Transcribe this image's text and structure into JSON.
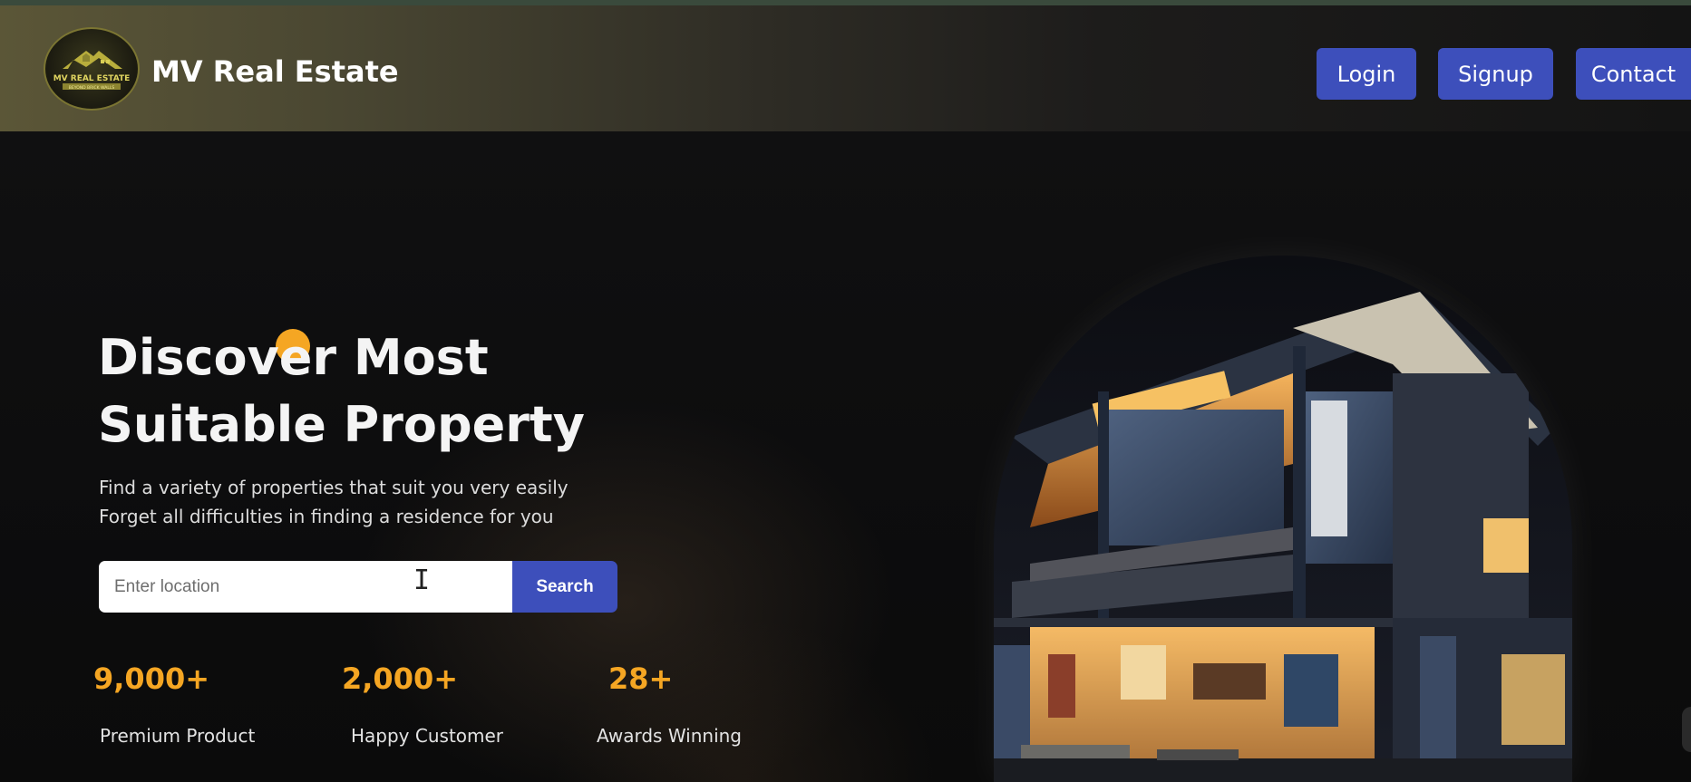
{
  "header": {
    "logo": {
      "text": "MV REAL ESTATE",
      "tagline": "BEYOND BRICK WALLS"
    },
    "brand": "MV Real Estate",
    "nav": {
      "login": "Login",
      "signup": "Signup",
      "contact": "Contact"
    }
  },
  "hero": {
    "title_line1": "Discover Most",
    "title_line2": "Suitable Property",
    "subtitle_line1": "Find a variety of properties that suit you very easily",
    "subtitle_line2": "Forget all difficulties in finding a residence for you"
  },
  "search": {
    "placeholder": "Enter location",
    "value": "",
    "button": "Search"
  },
  "stats": [
    {
      "value": "9,000+",
      "label": "Premium Product"
    },
    {
      "value": "2,000+",
      "label": "Happy Customer"
    },
    {
      "value": "28+",
      "label": "Awards Winning"
    }
  ],
  "colors": {
    "accent": "#3d4fbb",
    "highlight": "#f5a623",
    "background": "#0b0b0c"
  },
  "icons": {
    "cursor": "text-cursor-icon"
  }
}
